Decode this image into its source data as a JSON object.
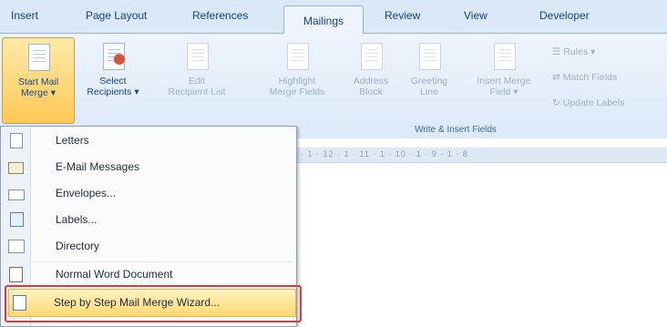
{
  "tabs": [
    "Insert",
    "Page Layout",
    "References",
    "Mailings",
    "Review",
    "View",
    "Developer"
  ],
  "active_tab": "Mailings",
  "ribbon": {
    "start_mail_merge": {
      "line1": "Start Mail",
      "line2": "Merge ▾"
    },
    "select_recipients": {
      "line1": "Select",
      "line2": "Recipients ▾"
    },
    "edit_recipient_list": {
      "line1": "Edit",
      "line2": "Recipient List"
    },
    "highlight_merge_fields": {
      "line1": "Highlight",
      "line2": "Merge Fields"
    },
    "address_block": {
      "line1": "Address",
      "line2": "Block"
    },
    "greeting_line": {
      "line1": "Greeting",
      "line2": "Line"
    },
    "insert_merge_field": {
      "line1": "Insert Merge",
      "line2": "Field ▾"
    },
    "rules": "Rules ▾",
    "match_fields": "Match Fields",
    "update_labels": "Update Labels",
    "group_write_insert": "Write & Insert Fields"
  },
  "ruler_marks": "· 1 · 12 · 1 · 11 · 1 · 10 · 1 · 9 · 1 · 8",
  "menu": {
    "items": [
      "Letters",
      "E-Mail Messages",
      "Envelopes...",
      "Labels...",
      "Directory",
      "Normal Word Document",
      "Step by Step Mail Merge Wizard..."
    ]
  },
  "colors": {
    "highlight_border": "#d93a3a",
    "accent": "#ffd873"
  }
}
